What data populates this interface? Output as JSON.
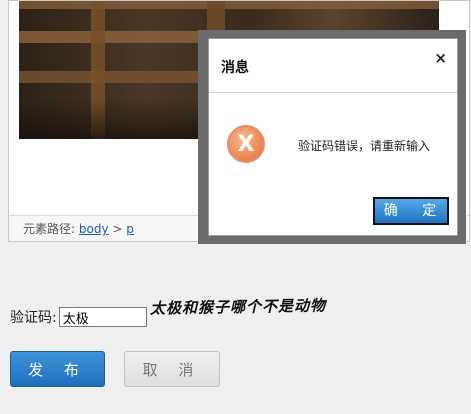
{
  "editor": {
    "path_label": "元素路径:",
    "path_items": [
      "body",
      "p"
    ],
    "path_separator": ">"
  },
  "captcha": {
    "label": "验证码:",
    "value": "太极",
    "question": "太极和猴子哪个不是动物"
  },
  "actions": {
    "publish_label": "发 布",
    "cancel_label": "取 消"
  },
  "dialog": {
    "title": "消息",
    "close_glyph": "×",
    "message": "验证码错误，请重新输入",
    "ok_label": "确 定",
    "icon": "error-x-icon"
  }
}
